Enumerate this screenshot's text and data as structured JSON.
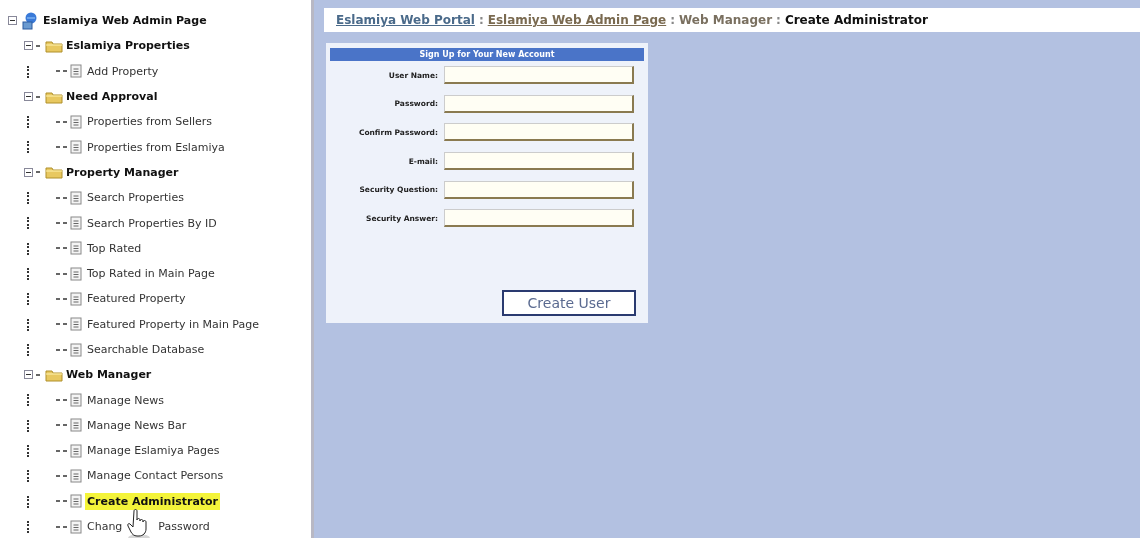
{
  "tree": {
    "label": "Eslamiya Web Admin Page",
    "expanded": true,
    "children": [
      {
        "label": "Eslamiya Properties",
        "expanded": true,
        "children": [
          {
            "label": "Add Property",
            "selected": false
          }
        ]
      },
      {
        "label": "Need Approval",
        "expanded": true,
        "children": [
          {
            "label": "Properties from Sellers",
            "selected": false
          },
          {
            "label": "Properties from Eslamiya",
            "selected": false
          }
        ]
      },
      {
        "label": "Property Manager",
        "expanded": true,
        "children": [
          {
            "label": "Search Properties",
            "selected": false
          },
          {
            "label": "Search Properties By ID",
            "selected": false
          },
          {
            "label": "Top Rated",
            "selected": false
          },
          {
            "label": "Top Rated in Main Page",
            "selected": false
          },
          {
            "label": "Featured Property",
            "selected": false
          },
          {
            "label": "Featured Property in Main Page",
            "selected": false
          },
          {
            "label": "Searchable Database",
            "selected": false
          }
        ]
      },
      {
        "label": "Web Manager",
        "expanded": true,
        "children": [
          {
            "label": "Manage News",
            "selected": false
          },
          {
            "label": "Manage News Bar",
            "selected": false
          },
          {
            "label": "Manage Eslamiya Pages",
            "selected": false
          },
          {
            "label": "Manage Contact Persons",
            "selected": false
          },
          {
            "label": "Create Administrator",
            "selected": true
          },
          {
            "label": "Chang",
            "label_after_cursor": "Password",
            "selected": false
          }
        ]
      }
    ]
  },
  "breadcrumb": {
    "links": [
      "Eslamiya Web Portal",
      "Eslamiya Web Admin Page"
    ],
    "section": "Web Manager",
    "current": "Create Administrator",
    "separator": ":"
  },
  "form": {
    "title": "Sign Up for Your New Account",
    "fields": [
      {
        "label": "User Name:"
      },
      {
        "label": "Password:"
      },
      {
        "label": "Confirm Password:"
      },
      {
        "label": "E-mail:"
      },
      {
        "label": "Security Question:"
      },
      {
        "label": "Security Answer:"
      }
    ],
    "button": "Create User"
  }
}
